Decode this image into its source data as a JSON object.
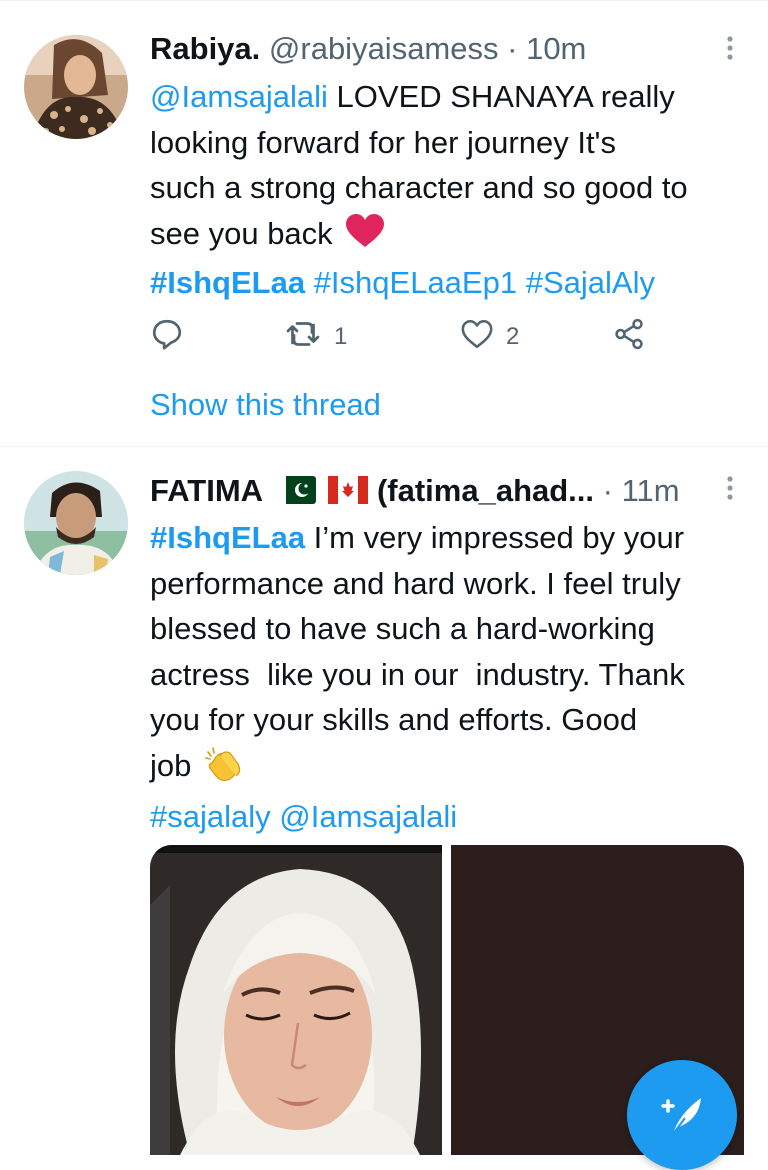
{
  "tweets": [
    {
      "name": "Rabiya.",
      "handle": "@rabiyaisamess",
      "separator": "·",
      "time": "10m",
      "text_mention": "@Iamsajalali",
      "text_line1_rest": " LOVED SHANAYA really",
      "text_line2": "looking forward for her journey It's",
      "text_line3": "such a strong character and so good to",
      "text_line4": "see you back",
      "hashtags": [
        "#IshqELaa",
        "#IshqELaaEp1",
        "#SajalAly"
      ],
      "reply_count": "",
      "retweet_count": "1",
      "like_count": "2",
      "show_thread": "Show this thread",
      "avatar_icon": "profile-avatar",
      "emoji_icon": "red-heart-icon"
    },
    {
      "name": "FATIMA",
      "handle": "(fatima_ahad...",
      "separator": "·",
      "time": "11m",
      "hashtag_lead": "#IshqELaa",
      "text_line1_rest": " I’m very impressed by your",
      "text_line2": "performance and hard work. I feel truly",
      "text_line3": "blessed to have such a hard-working",
      "text_line4": "actress  like you in our  industry. Thank",
      "text_line5": "you for your skills and efforts. Good",
      "text_line6": "job",
      "tag_hashtag": "#sajalaly",
      "tag_mention": "@Iamsajalali",
      "flags": [
        "pakistan-flag-icon",
        "canada-flag-icon"
      ],
      "emoji_icon": "clapping-hands-icon"
    }
  ],
  "colors": {
    "accent": "#1d9bf0",
    "text": "#0f1419",
    "secondary": "#536471",
    "heart": "#e0245e",
    "divider": "#eff3f4"
  }
}
